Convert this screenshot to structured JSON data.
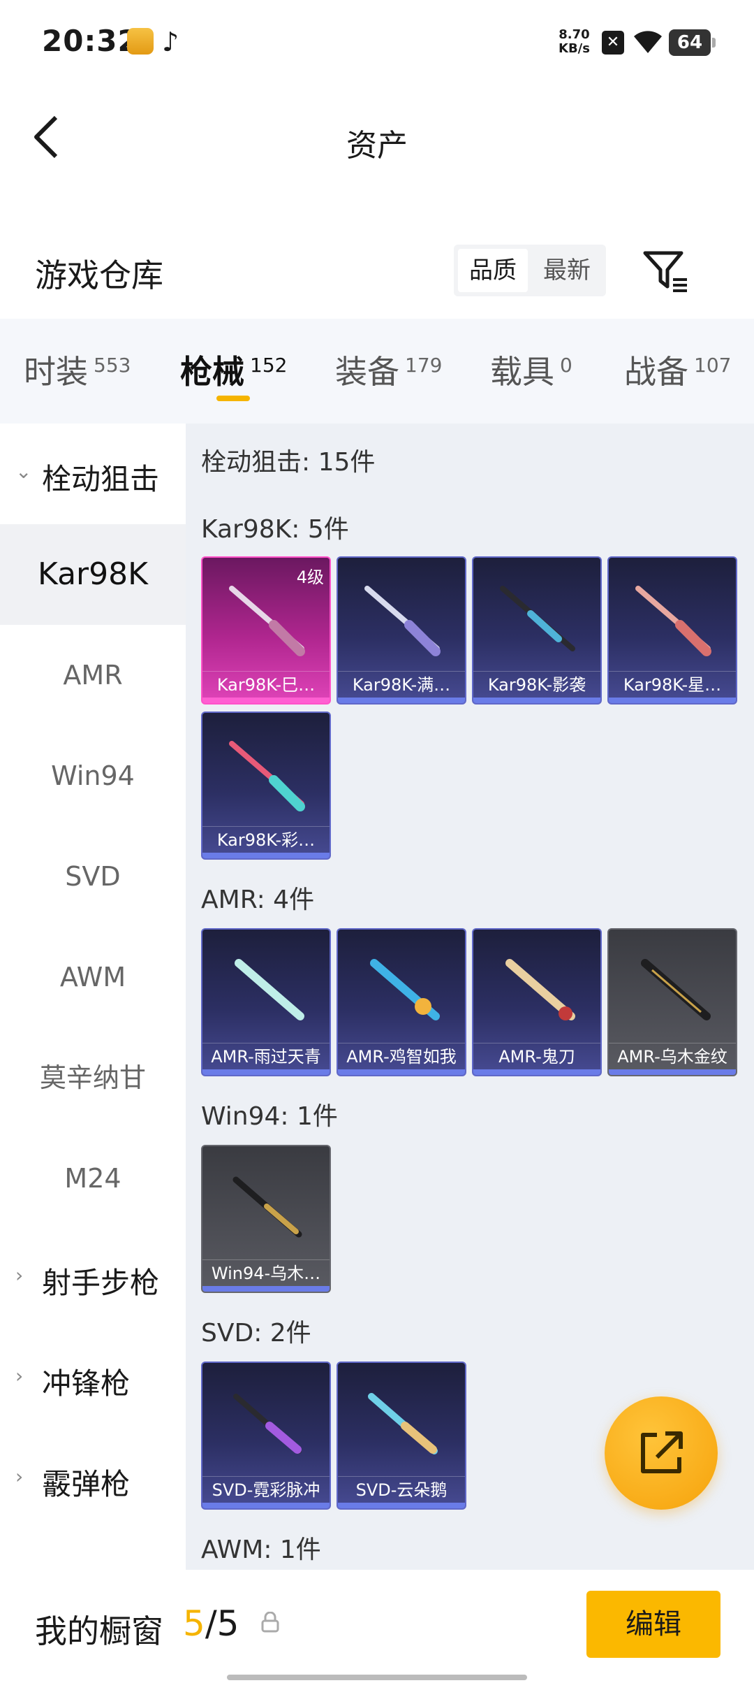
{
  "status_bar": {
    "time": "20:32",
    "net_speed_value": "8.70",
    "net_speed_unit": "KB/s",
    "battery": "64"
  },
  "header": {
    "title": "资产"
  },
  "warehouse": {
    "title": "游戏仓库",
    "sort_options": [
      "品质",
      "最新"
    ],
    "selected_sort": "品质"
  },
  "tabs": [
    {
      "label": "时装",
      "count": "553"
    },
    {
      "label": "枪械",
      "count": "152"
    },
    {
      "label": "装备",
      "count": "179"
    },
    {
      "label": "载具",
      "count": "0"
    },
    {
      "label": "战备",
      "count": "107"
    }
  ],
  "active_tab": "枪械",
  "sidebar": {
    "categories": [
      {
        "label": "栓动狙击",
        "expanded": true
      },
      {
        "label": "射手步枪",
        "expanded": false
      },
      {
        "label": "冲锋枪",
        "expanded": false
      },
      {
        "label": "霰弹枪",
        "expanded": false
      }
    ],
    "subitems": [
      "Kar98K",
      "AMR",
      "Win94",
      "SVD",
      "AWM",
      "莫辛纳甘",
      "M24"
    ],
    "active_subitem": "Kar98K"
  },
  "main": {
    "category_header": "栓动狙击: 15件",
    "groups": [
      {
        "title": "Kar98K: 5件",
        "items": [
          {
            "name": "Kar98K-巳…",
            "level": "4级",
            "style": "pink"
          },
          {
            "name": "Kar98K-满…",
            "style": "blue"
          },
          {
            "name": "Kar98K-影袭",
            "style": "blue"
          },
          {
            "name": "Kar98K-星…",
            "style": "blue"
          },
          {
            "name": "Kar98K-彩…",
            "style": "blue"
          }
        ]
      },
      {
        "title": "AMR: 4件",
        "items": [
          {
            "name": "AMR-雨过天青",
            "style": "blue"
          },
          {
            "name": "AMR-鸡智如我",
            "style": "blue"
          },
          {
            "name": "AMR-鬼刀",
            "style": "blue"
          },
          {
            "name": "AMR-乌木金纹",
            "style": "gray"
          }
        ]
      },
      {
        "title": "Win94: 1件",
        "items": [
          {
            "name": "Win94-乌木…",
            "style": "gray"
          }
        ]
      },
      {
        "title": "SVD: 2件",
        "items": [
          {
            "name": "SVD-霓彩脉冲",
            "style": "blue"
          },
          {
            "name": "SVD-云朵鹅",
            "style": "blue"
          }
        ]
      },
      {
        "title": "AWM: 1件",
        "items": []
      }
    ]
  },
  "bottom_bar": {
    "label": "我的橱窗",
    "current": "5",
    "separator": "/",
    "total": "5",
    "edit_label": "编辑"
  },
  "colors": {
    "accent": "#f5b400",
    "rarity_pink": "#e044b9",
    "rarity_blue": "#474b93",
    "rarity_gray": "#5a5b62"
  },
  "icons": [
    "back-arrow-icon",
    "filter-icon",
    "share-external-icon",
    "lock-icon",
    "wifi-icon",
    "chevron-down-icon",
    "chevron-right-icon"
  ]
}
